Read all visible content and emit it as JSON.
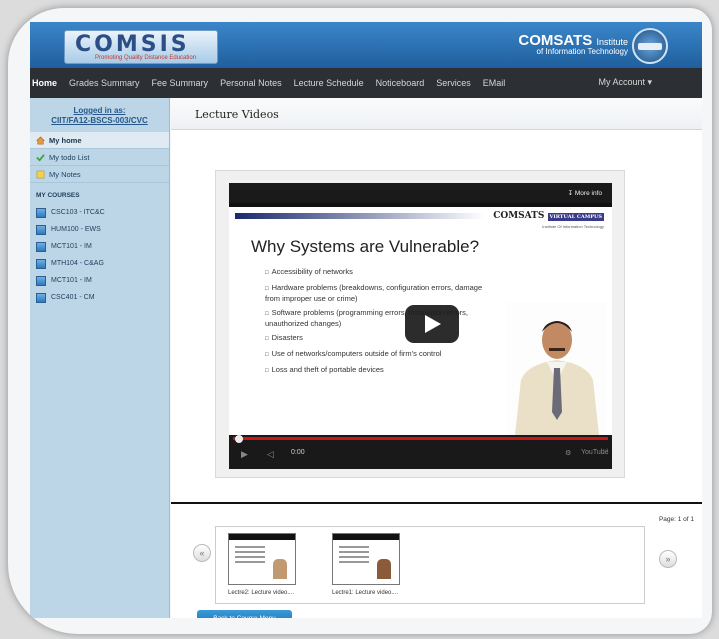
{
  "header": {
    "logo_text": "COMSIS",
    "logo_tagline": "Promoting Quality Distance Education",
    "institute_name": "COMSATS",
    "institute_suffix": "Institute",
    "institute_sub": "of Information Technology"
  },
  "nav": {
    "items": [
      "Home",
      "Grades Summary",
      "Fee Summary",
      "Personal Notes",
      "Lecture Schedule",
      "Noticeboard",
      "Services",
      "EMail"
    ],
    "account": "My Account ▾"
  },
  "sidebar": {
    "logged_in_label": "Logged in as:",
    "user_id": "CIIT/FA12-BSCS-003/CVC",
    "links": [
      "My home",
      "My todo List",
      "My Notes"
    ],
    "courses_title": "MY COURSES",
    "courses": [
      "CSC103 - ITC&C",
      "HUM100 - EWS",
      "MCT101 - IM",
      "MTH104 - C&AG",
      "MCT101 - IM",
      "CSC401 - CM"
    ]
  },
  "main": {
    "page_title": "Lecture Videos",
    "video": {
      "more_info": "More info",
      "slide_logo": "COMSATS",
      "slide_logo_badge": "VIRTUAL CAMPUS",
      "slide_logo_sub": "Institute Of Information Technology",
      "slide_heading": "Why Systems are Vulnerable?",
      "bullets": [
        "Accessibility of networks",
        "Hardware problems (breakdowns, configuration errors, damage from improper use or crime)",
        "Software problems (programming errors, installation errors, unauthorized changes)",
        "Disasters",
        "Use of networks/computers outside of firm's control",
        "Loss and theft of portable devices"
      ],
      "time": "0:00",
      "yt_label": "YouTube"
    },
    "page_info": "Page: 1 of 1",
    "thumbnails": [
      "Lectre2: Lecture video....",
      "Lectre1: Lecture video...."
    ],
    "prev_arrow": "«",
    "next_arrow": "»",
    "back_button": "Back to Course Menu"
  },
  "colors": {
    "header_blue": "#1f5f9d",
    "nav_dark": "#2c2f33",
    "sidebar_blue": "#bcd6e8",
    "progress_red": "#c71717",
    "button_blue": "#1a6faf"
  },
  "icons": [
    "home-icon",
    "check-icon",
    "notes-icon",
    "course-icon",
    "play-icon",
    "volume-icon",
    "fullscreen-icon",
    "info-icon"
  ]
}
